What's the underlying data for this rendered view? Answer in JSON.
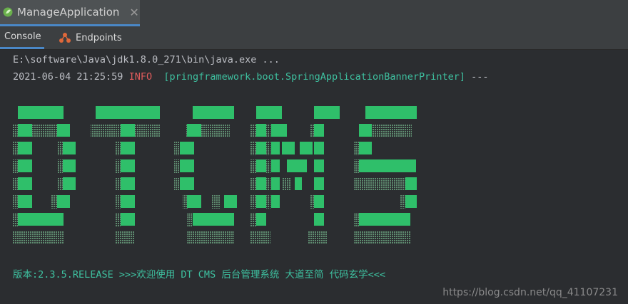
{
  "window": {
    "tab_title": "ManageApplication",
    "close_glyph": "✕"
  },
  "subtabs": [
    {
      "label": "Console",
      "active": true
    },
    {
      "label": "Endpoints",
      "icon": "endpoints-icon",
      "active": false
    }
  ],
  "console": {
    "command_line": "E:\\software\\Java\\jdk1.8.0_271\\bin\\java.exe ...",
    "log": {
      "timestamp": "2021-06-04 21:25:59",
      "level": "INFO",
      "logger": "[pringframework.boot.SpringApplicationBannerPrinter]",
      "dashes": "---"
    },
    "banner_text": "DTCMS",
    "status": "版本:2.3.5.RELEASE >>>欢迎使用 DT CMS 后台管理系统 大道至简 代码玄学<<<"
  },
  "watermark": "https://blog.csdn.net/qq_41107231",
  "colors": {
    "banner_green": "#2fbf6a",
    "banner_shade": "#5e8b6f",
    "info_red": "#e05c5c",
    "logger_teal": "#3ec1a0",
    "accent_blue": "#4a88c7"
  }
}
